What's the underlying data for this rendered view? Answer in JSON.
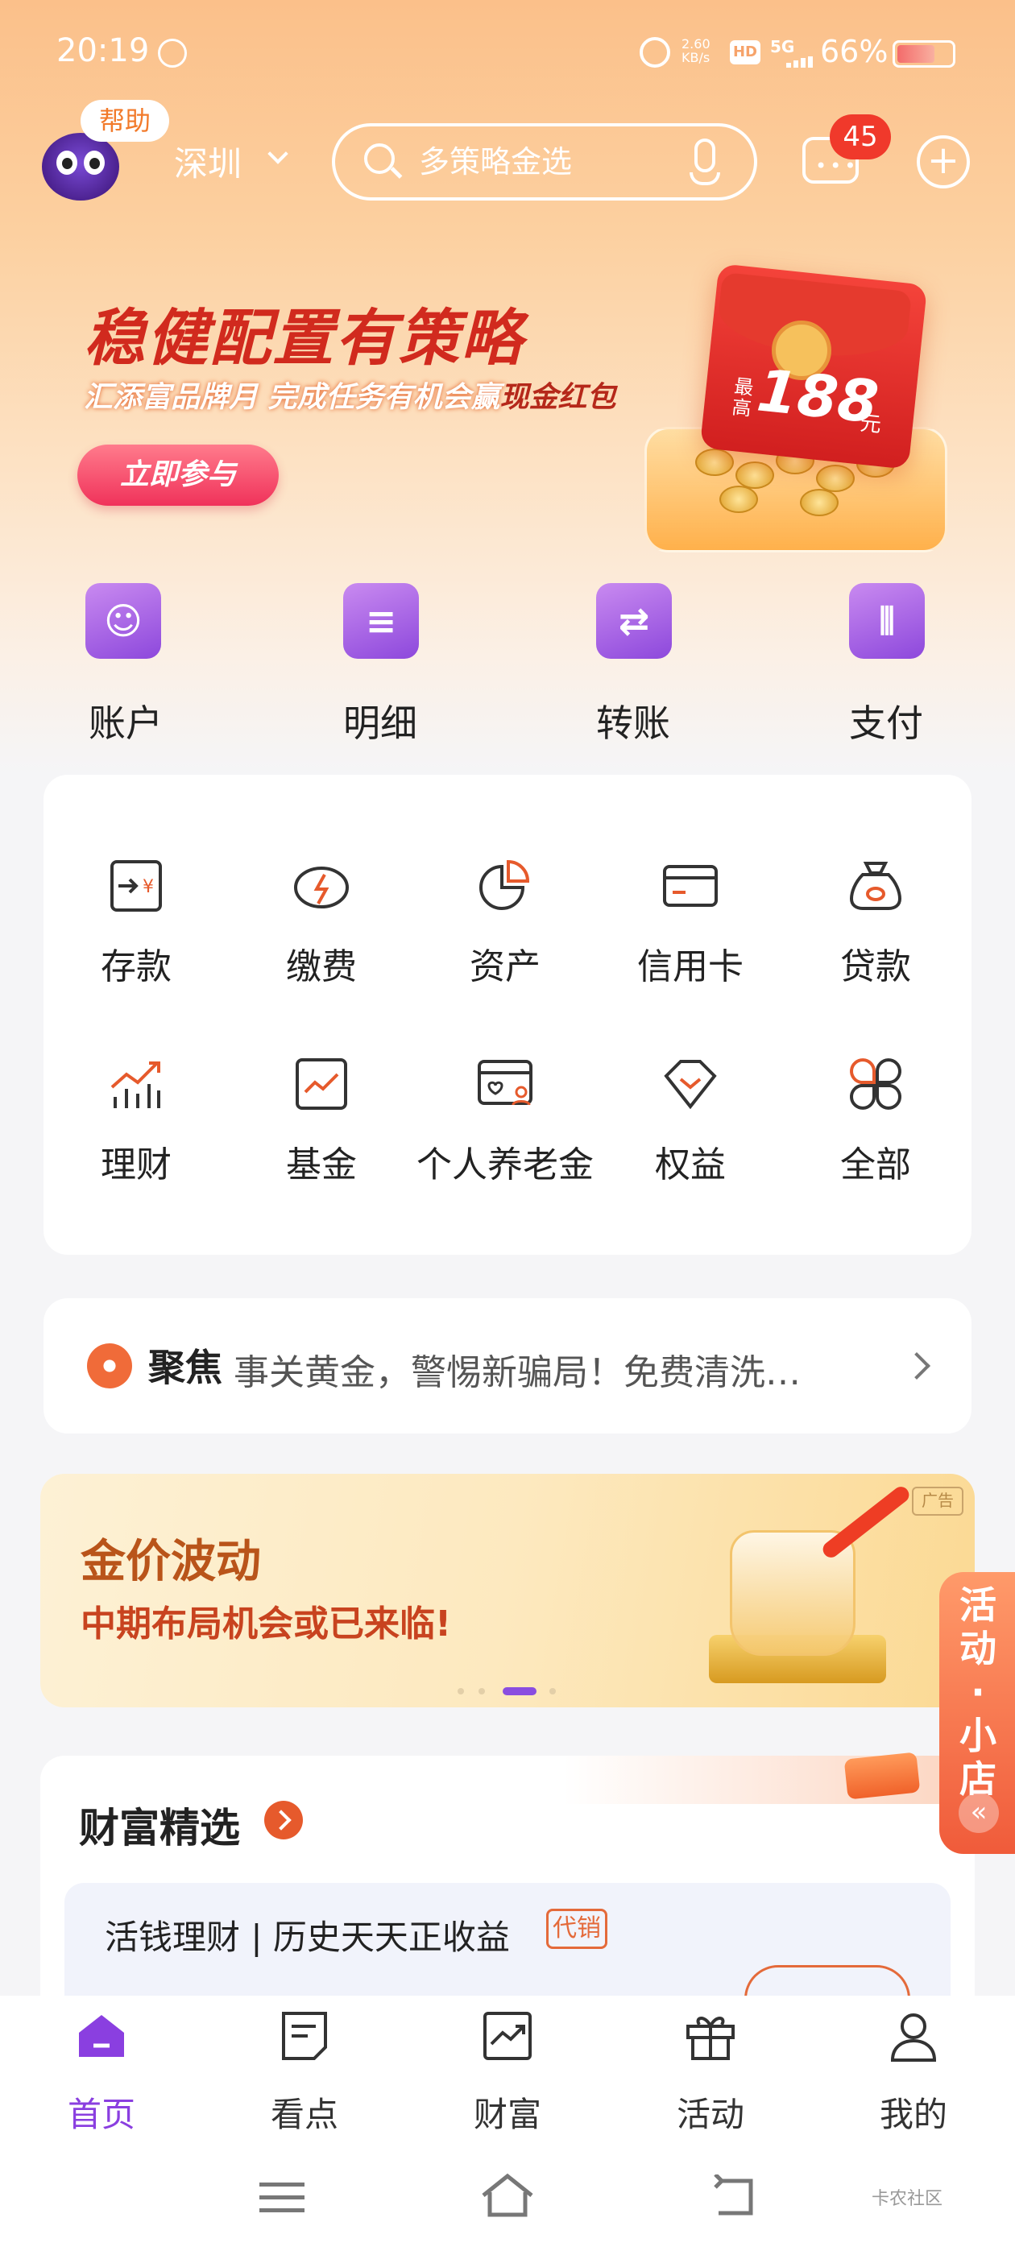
{
  "status_bar": {
    "time": "20:19",
    "net_speed": "2.60\nKB/s",
    "hd": "HD",
    "signal": "5G",
    "battery": "66%"
  },
  "header": {
    "help_label": "帮助",
    "city": "深圳",
    "search_placeholder": "多策略金选",
    "message_badge": "45"
  },
  "banner": {
    "title": "稳健配置有策略",
    "subtitle": "汇添富品牌月 完成任务有机会赢",
    "subtitle_emphasis": "现金红包",
    "button": "立即参与",
    "redpack_small": "最高",
    "redpack_amount": "188",
    "redpack_unit": "元"
  },
  "quick_actions": [
    {
      "label": "账户",
      "icon": "account-icon"
    },
    {
      "label": "明细",
      "icon": "details-calendar-icon"
    },
    {
      "label": "转账",
      "icon": "transfer-icon"
    },
    {
      "label": "支付",
      "icon": "pay-icon"
    }
  ],
  "services": [
    {
      "label": "存款",
      "icon": "deposit-icon"
    },
    {
      "label": "缴费",
      "icon": "bill-pay-icon"
    },
    {
      "label": "资产",
      "icon": "assets-pie-icon"
    },
    {
      "label": "信用卡",
      "icon": "credit-card-icon"
    },
    {
      "label": "贷款",
      "icon": "loan-bag-icon"
    },
    {
      "label": "理财",
      "icon": "wealth-chart-icon"
    },
    {
      "label": "基金",
      "icon": "fund-icon"
    },
    {
      "label": "个人养老金",
      "icon": "pension-icon"
    },
    {
      "label": "权益",
      "icon": "benefits-diamond-icon"
    },
    {
      "label": "全部",
      "icon": "all-grid-icon"
    }
  ],
  "focus": {
    "label": "聚焦",
    "text": "事关黄金，警惕新骗局！免费清洗…"
  },
  "gold_ad": {
    "tag": "广告",
    "title": "金价波动",
    "subtitle": "中期布局机会或已来临!"
  },
  "floating_tab": {
    "text": "活动·小店",
    "collapse_icon": "«"
  },
  "wealth": {
    "title": "财富精选",
    "product_title": "活钱理财 | 历史天天正收益",
    "product_tag": "代销"
  },
  "bottom_nav": [
    {
      "label": "首页",
      "icon": "home-icon",
      "active": true
    },
    {
      "label": "看点",
      "icon": "news-icon",
      "active": false
    },
    {
      "label": "财富",
      "icon": "wealth-trend-icon",
      "active": false
    },
    {
      "label": "活动",
      "icon": "gift-icon",
      "active": false
    },
    {
      "label": "我的",
      "icon": "profile-icon",
      "active": false
    }
  ],
  "watermark": "卡农社区",
  "colors": {
    "accent": "#8a3fe0",
    "brand_orange": "#f27a2a",
    "badge_red": "#f0392b"
  }
}
